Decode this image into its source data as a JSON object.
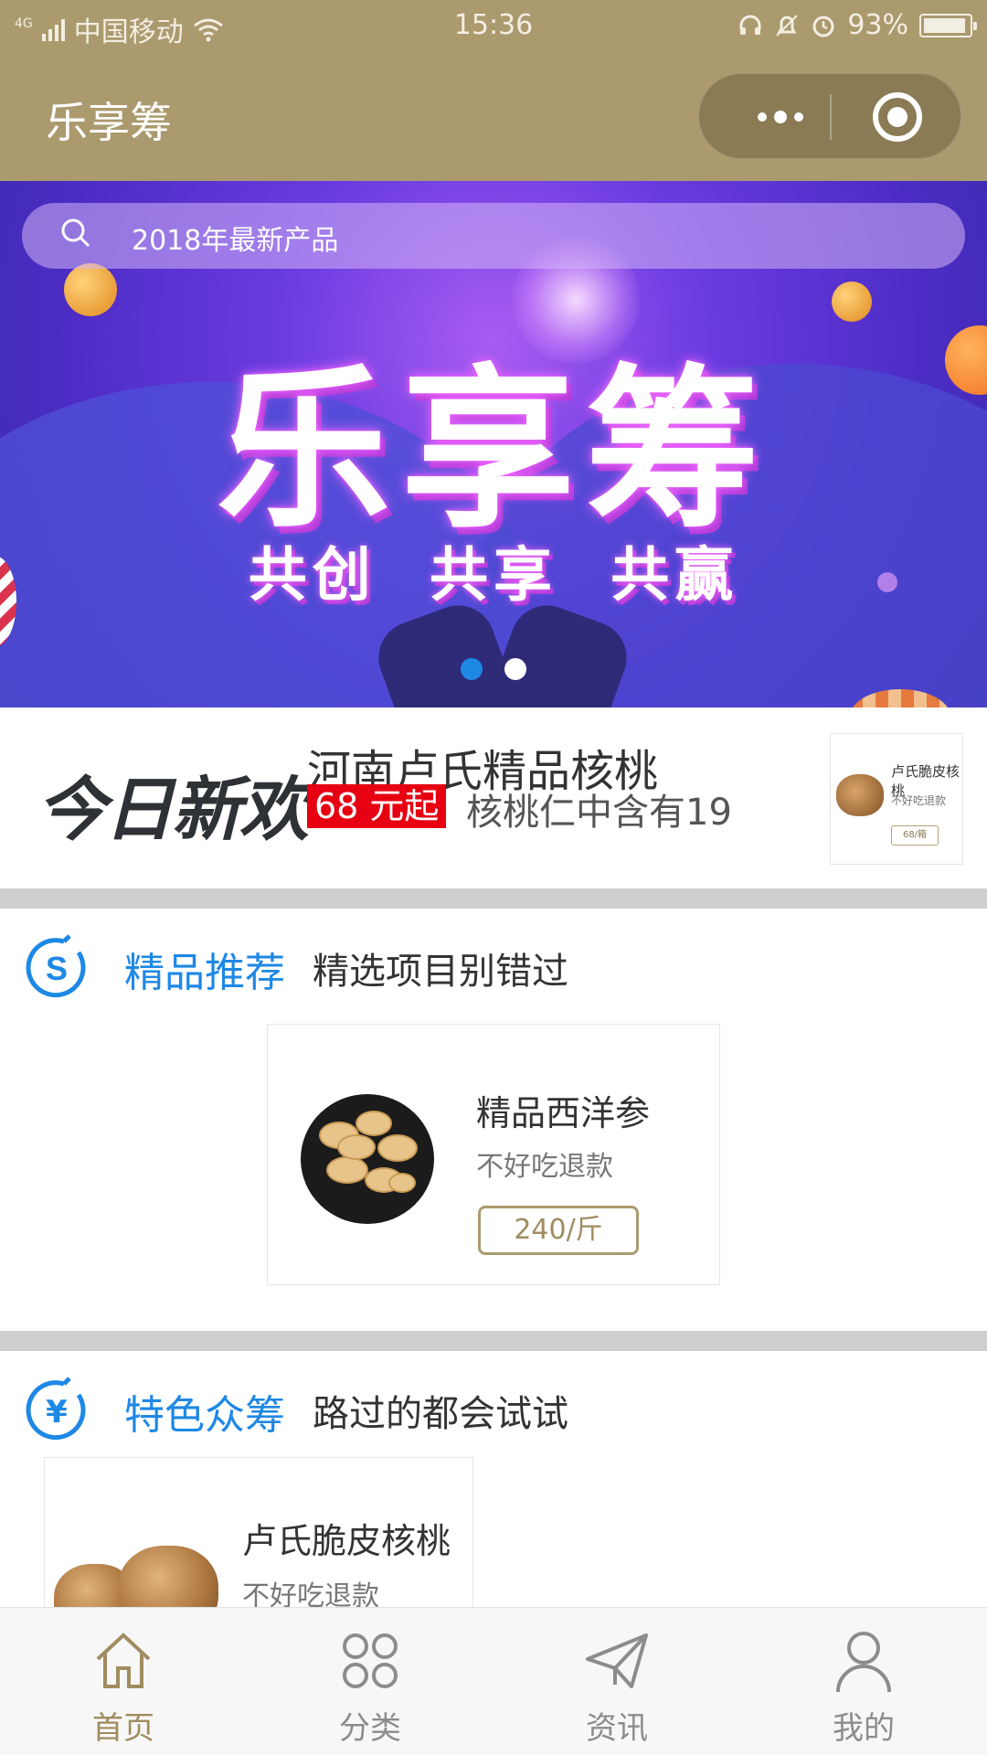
{
  "status_bar": {
    "network": "4G",
    "carrier": "中国移动",
    "time": "15:36",
    "battery": "93%",
    "battery_level": 0.93
  },
  "nav": {
    "title": "乐享筹",
    "more_icon": "more-dots-icon",
    "close_icon": "target-icon"
  },
  "banner": {
    "search_placeholder": "2018年最新产品",
    "title": "乐享筹",
    "slogan": "共创 共享 共赢",
    "dot_count": 2,
    "active_dot": 0
  },
  "today_new": {
    "badge": "今日新欢",
    "title": "河南卢氏精品核桃",
    "price_tag": "68 元起",
    "desc": "核桃仁中含有19",
    "thumb": {
      "name": "卢氏脆皮核桃",
      "note": "不好吃退款",
      "price": "68/箱"
    }
  },
  "featured": {
    "icon": "s-circle-icon",
    "title": "精品推荐",
    "subtitle": "精选项目别错过",
    "item": {
      "name": "精品西洋参",
      "note": "不好吃退款",
      "price": "240/斤"
    }
  },
  "crowdfunding": {
    "icon": "yen-circle-icon",
    "title": "特色众筹",
    "subtitle": "路过的都会试试",
    "item": {
      "name": "卢氏脆皮核桃",
      "note": "不好吃退款"
    }
  },
  "tabbar": {
    "tabs": [
      {
        "label": "首页",
        "icon": "home-icon",
        "active": true
      },
      {
        "label": "分类",
        "icon": "category-icon",
        "active": false
      },
      {
        "label": "资讯",
        "icon": "paper-plane-icon",
        "active": false
      },
      {
        "label": "我的",
        "icon": "user-icon",
        "active": false
      }
    ]
  },
  "colors": {
    "header": "#ab9a6e",
    "accent_blue": "#1e88e5",
    "price_red": "#e60012",
    "tab_active": "#a08c5f"
  }
}
